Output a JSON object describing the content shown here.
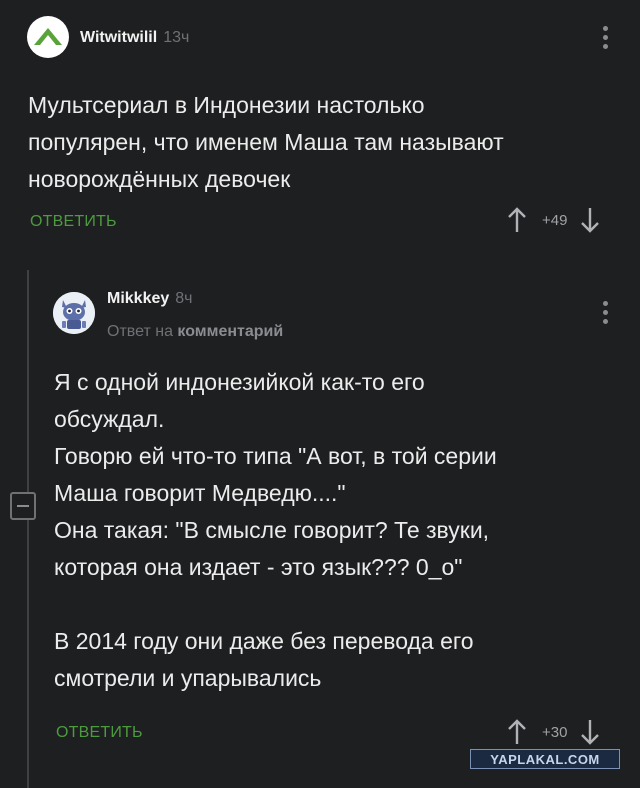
{
  "comment1": {
    "username": "Witwitwilil",
    "time": "13ч",
    "text": "Мультсериал в Индонезии настолько\nпопулярен, что именем Маша там называют\nноворождённых девочек",
    "reply_label": "ОТВЕТИТЬ",
    "score": "+49"
  },
  "comment2": {
    "username": "Mikkkey",
    "time": "8ч",
    "reply_to_prefix": "Ответ на",
    "reply_to_link": "комментарий",
    "text": "Я с одной индонезийкой как-то его\nобсуждал.\nГоворю ей что-то типа \"А вот, в той серии\nМаша говорит Медведю....\"\nОна такая: \"В смысле говорит? Те звуки,\nкоторая она издает - это язык??? 0_о\"\n\nВ 2014 году они даже без перевода его\nсмотрели и упарывались",
    "reply_label": "ОТВЕТИТЬ",
    "score": "+30"
  },
  "watermark": "YAPLAKAL.COM",
  "colors": {
    "background": "#1e1f21",
    "accent_green": "#4c9b3e",
    "muted": "#6f7175"
  }
}
